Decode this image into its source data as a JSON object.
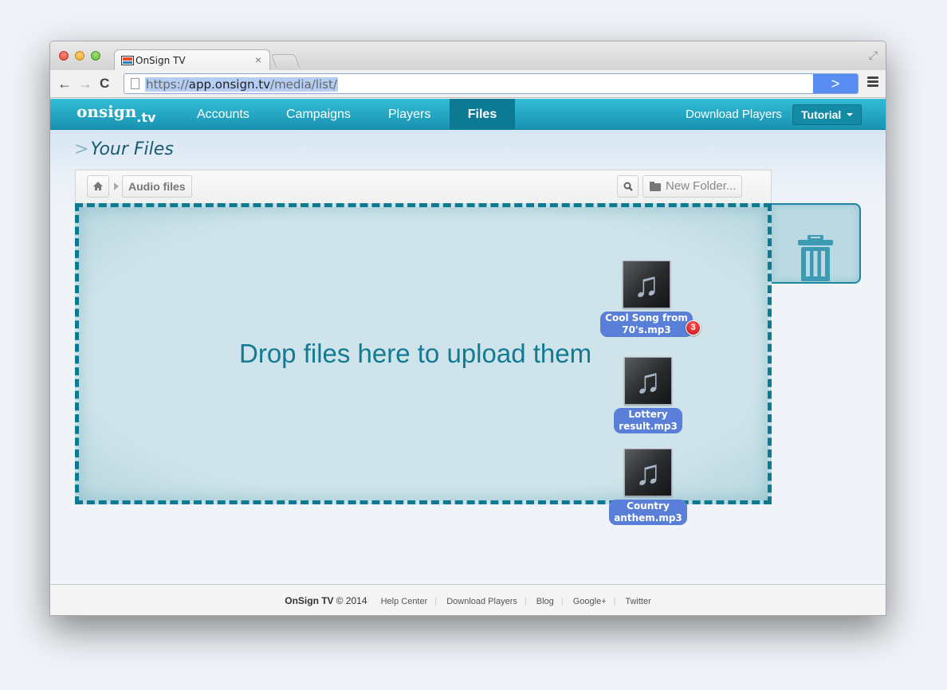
{
  "browser": {
    "tab_title": "OnSign TV",
    "url_prefix": "https://",
    "url_host": "app.onsign.tv",
    "url_path": "/media/list/"
  },
  "app": {
    "logo_main": "onsign",
    "logo_suffix": ".tv",
    "nav": [
      {
        "label": "Accounts",
        "active": false
      },
      {
        "label": "Campaigns",
        "active": false
      },
      {
        "label": "Players",
        "active": false
      },
      {
        "label": "Files",
        "active": true
      }
    ],
    "download_players": "Download Players",
    "tutorial": "Tutorial"
  },
  "page": {
    "title": "Your Files",
    "breadcrumb": {
      "current": "Audio files"
    },
    "new_folder": "New Folder...",
    "drop_text": "Drop files here to upload them",
    "selected_count": "3",
    "files": [
      {
        "name_line1": "Cool Song from",
        "name_line2": "70's.mp3",
        "icon": "music-note-icon"
      },
      {
        "name_line1": "Lottery",
        "name_line2": "result.mp3",
        "icon": "music-note-icon"
      },
      {
        "name_line1": "Country",
        "name_line2": "anthem.mp3",
        "icon": "music-note-icon"
      }
    ]
  },
  "footer": {
    "brand": "OnSign TV",
    "copyright": "© 2014",
    "links": [
      "Help Center",
      "Download Players",
      "Blog",
      "Google+",
      "Twitter"
    ]
  },
  "colors": {
    "nav_bg": "#1893b1",
    "accent": "#0c7a92",
    "file_label": "#5a7fd8",
    "badge": "#c80d0d"
  }
}
